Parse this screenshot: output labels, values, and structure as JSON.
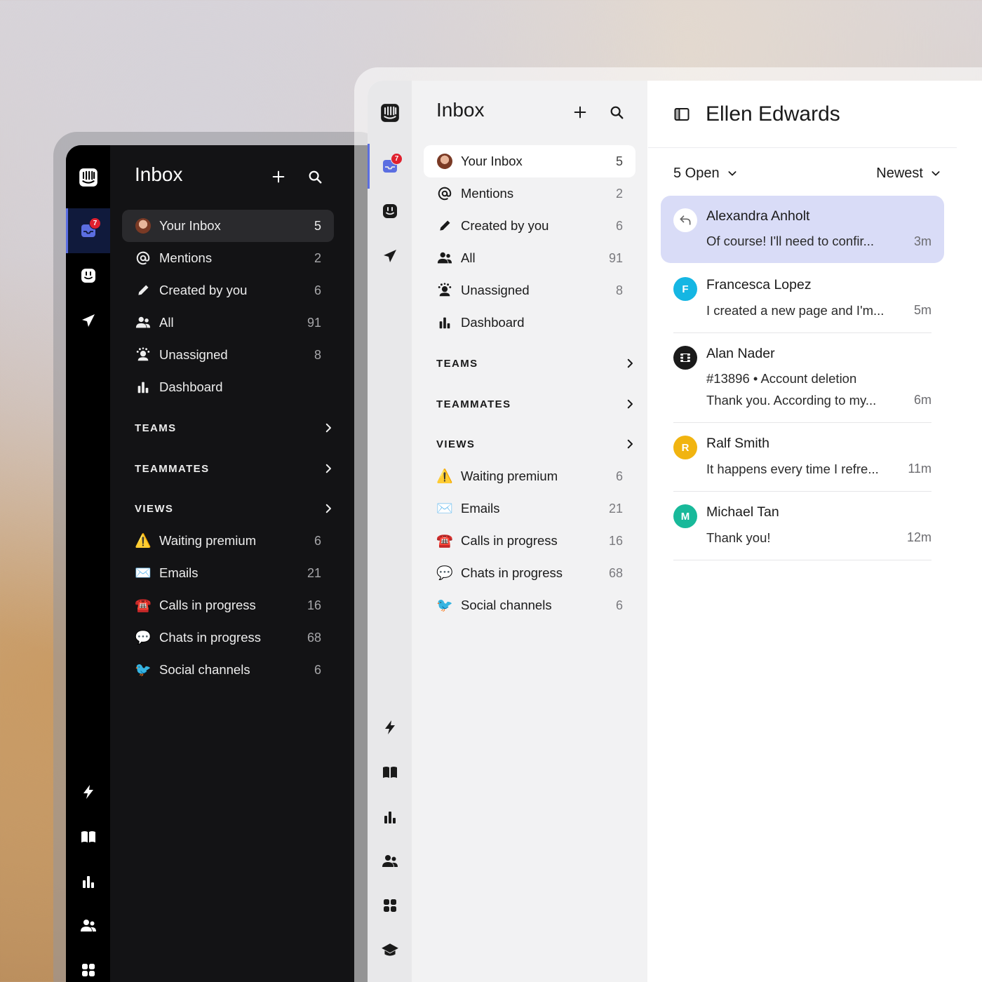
{
  "panel": {
    "title": "Inbox",
    "nav": [
      {
        "label": "Your Inbox",
        "count": "5"
      },
      {
        "label": "Mentions",
        "count": "2"
      },
      {
        "label": "Created by you",
        "count": "6"
      },
      {
        "label": "All",
        "count": "91"
      },
      {
        "label": "Unassigned",
        "count": "8"
      },
      {
        "label": "Dashboard",
        "count": ""
      }
    ],
    "sections": [
      {
        "label": "TEAMS"
      },
      {
        "label": "TEAMMATES"
      },
      {
        "label": "VIEWS"
      }
    ],
    "views": [
      {
        "label": "Waiting premium",
        "count": "6",
        "icon": "⚠️"
      },
      {
        "label": "Emails",
        "count": "21",
        "icon": "✉️"
      },
      {
        "label": "Calls in progress",
        "count": "16",
        "icon": "☎️"
      },
      {
        "label": "Chats in progress",
        "count": "68",
        "icon": "💬"
      },
      {
        "label": "Social channels",
        "count": "6",
        "icon": "🐦"
      }
    ]
  },
  "rail": {
    "badge": "7"
  },
  "conversation": {
    "assignee": "Ellen Edwards",
    "filter_status": "5 Open",
    "filter_sort": "Newest",
    "items": [
      {
        "name": "Alexandra Anholt",
        "preview": "Of course! I'll need to confir...",
        "time": "3m",
        "initial": "",
        "color": "#ffffff"
      },
      {
        "name": "Francesca Lopez",
        "preview": "I created a new page and I'm...",
        "time": "5m",
        "initial": "F",
        "color": "#15b6e3"
      },
      {
        "name": "Alan Nader",
        "subject": "#13896 • Account deletion",
        "preview": "Thank you. According to my...",
        "time": "6m",
        "initial": "",
        "color": "#1a1a1a"
      },
      {
        "name": "Ralf Smith",
        "preview": "It happens every time I refre...",
        "time": "11m",
        "initial": "R",
        "color": "#f1b410"
      },
      {
        "name": "Michael Tan",
        "preview": "Thank you!",
        "time": "12m",
        "initial": "M",
        "color": "#18b99a"
      }
    ]
  },
  "colors": {
    "accent": "#5b6ee1",
    "badge": "#e0202e",
    "selected_card": "#d9dcf7"
  }
}
